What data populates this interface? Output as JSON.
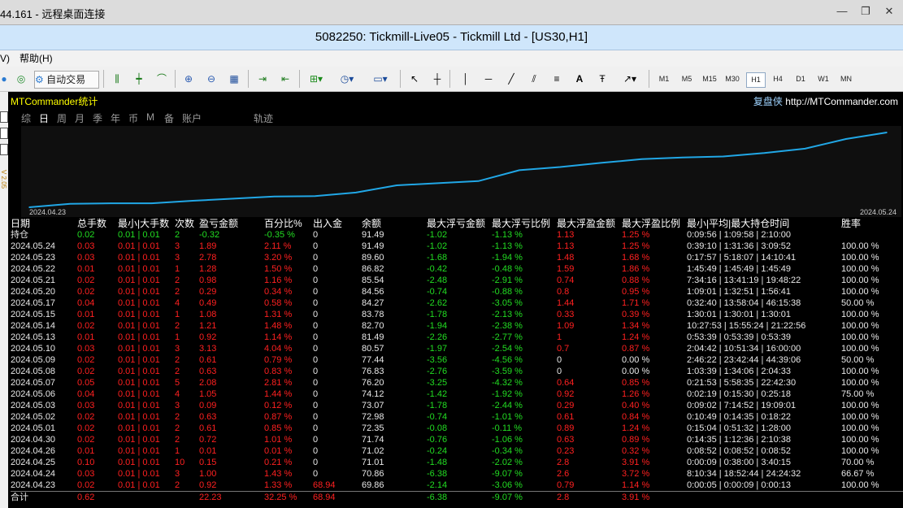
{
  "rdp": {
    "title": "44.161 - 远程桌面连接",
    "min": "—",
    "restore": "❐",
    "close": "✕"
  },
  "window_title": "5082250: Tickmill-Live05 - Tickmill Ltd - [US30,H1]",
  "menu": {
    "items": [
      "V)",
      "帮助(H)"
    ]
  },
  "toolbar": {
    "autotrade": "自动交易",
    "timeframes": [
      "M1",
      "M5",
      "M15",
      "M30",
      "H1",
      "H4",
      "D1",
      "W1",
      "MN"
    ],
    "selected_timeframe": "H1"
  },
  "left_strip": {
    "label": "V 2.05"
  },
  "panel": {
    "title": "MTCommander统计",
    "brand_name": "复盘侠",
    "brand_url": "http://MTCommander.com",
    "tabs": [
      {
        "label": "综",
        "active": false
      },
      {
        "label": "日",
        "active": true
      },
      {
        "label": "周",
        "active": false
      },
      {
        "label": "月",
        "active": false
      },
      {
        "label": "季",
        "active": false
      },
      {
        "label": "年",
        "active": false
      },
      {
        "label": "币",
        "active": false
      },
      {
        "label": "M",
        "active": false
      },
      {
        "label": "备",
        "active": false
      },
      {
        "label": "账户",
        "active": false
      },
      {
        "label": "轨迹",
        "active": false
      }
    ]
  },
  "chart_data": {
    "type": "line",
    "x": [
      "2024.04.23",
      "2024.04.24",
      "2024.04.25",
      "2024.04.26",
      "2024.04.30",
      "2024.05.01",
      "2024.05.02",
      "2024.05.03",
      "2024.05.06",
      "2024.05.07",
      "2024.05.08",
      "2024.05.09",
      "2024.05.10",
      "2024.05.13",
      "2024.05.14",
      "2024.05.15",
      "2024.05.17",
      "2024.05.20",
      "2024.05.21",
      "2024.05.22",
      "2024.05.23",
      "2024.05.24"
    ],
    "values": [
      69.86,
      70.86,
      71.01,
      71.02,
      71.74,
      72.35,
      72.98,
      73.07,
      74.12,
      76.2,
      76.83,
      77.44,
      80.57,
      81.49,
      82.7,
      83.78,
      84.27,
      84.56,
      85.54,
      86.82,
      89.6,
      91.49
    ],
    "x_start_label": "2024.04.23",
    "x_end_label": "2024.05.24",
    "line_color": "#21a7e6",
    "grid": false,
    "legend": "none"
  },
  "table": {
    "headers": [
      "日期",
      "总手数",
      "最小|大手数",
      "次数",
      "盈亏金额",
      "百分比%",
      "出入金",
      "余额",
      "最大浮亏金额",
      "最大浮亏比例",
      "最大浮盈金额",
      "最大浮盈比例",
      "最小|平均|最大持仓时间",
      "胜率"
    ],
    "holdings": {
      "label": "持仓",
      "lots": "0.02",
      "minmax": "0.01 | 0.01",
      "count": "2",
      "pnl": "-0.32",
      "pct": "-0.35 %",
      "dw": "0",
      "balance": "91.49",
      "fl": "-1.02",
      "flp": "-1.13 %",
      "fp": "1.13",
      "fpp": "1.25 %",
      "time": "0:09:56 | 1:09:58 | 2:10:00",
      "win": ""
    },
    "rows": [
      {
        "date": "2024.05.24",
        "lots": "0.03",
        "minmax": "0.01 | 0.01",
        "count": "3",
        "pnl": "1.89",
        "pct": "2.11 %",
        "dw": "0",
        "balance": "91.49",
        "fl": "-1.02",
        "flp": "-1.13 %",
        "fp": "1.13",
        "fpp": "1.25 %",
        "time": "0:39:10 | 1:31:36 | 3:09:52",
        "win": "100.00 %"
      },
      {
        "date": "2024.05.23",
        "lots": "0.03",
        "minmax": "0.01 | 0.01",
        "count": "3",
        "pnl": "2.78",
        "pct": "3.20 %",
        "dw": "0",
        "balance": "89.60",
        "fl": "-1.68",
        "flp": "-1.94 %",
        "fp": "1.48",
        "fpp": "1.68 %",
        "time": "0:17:57 | 5:18:07 | 14:10:41",
        "win": "100.00 %"
      },
      {
        "date": "2024.05.22",
        "lots": "0.01",
        "minmax": "0.01 | 0.01",
        "count": "1",
        "pnl": "1.28",
        "pct": "1.50 %",
        "dw": "0",
        "balance": "86.82",
        "fl": "-0.42",
        "flp": "-0.48 %",
        "fp": "1.59",
        "fpp": "1.86 %",
        "time": "1:45:49 | 1:45:49 | 1:45:49",
        "win": "100.00 %"
      },
      {
        "date": "2024.05.21",
        "lots": "0.02",
        "minmax": "0.01 | 0.01",
        "count": "2",
        "pnl": "0.98",
        "pct": "1.16 %",
        "dw": "0",
        "balance": "85.54",
        "fl": "-2.48",
        "flp": "-2.91 %",
        "fp": "0.74",
        "fpp": "0.88 %",
        "time": "7:34:16 | 13:41:19 | 19:48:22",
        "win": "100.00 %"
      },
      {
        "date": "2024.05.20",
        "lots": "0.02",
        "minmax": "0.01 | 0.01",
        "count": "2",
        "pnl": "0.29",
        "pct": "0.34 %",
        "dw": "0",
        "balance": "84.56",
        "fl": "-0.74",
        "flp": "-0.88 %",
        "fp": "0.8",
        "fpp": "0.95 %",
        "time": "1:09:01 | 1:32:51 | 1:56:41",
        "win": "100.00 %"
      },
      {
        "date": "2024.05.17",
        "lots": "0.04",
        "minmax": "0.01 | 0.01",
        "count": "4",
        "pnl": "0.49",
        "pct": "0.58 %",
        "dw": "0",
        "balance": "84.27",
        "fl": "-2.62",
        "flp": "-3.05 %",
        "fp": "1.44",
        "fpp": "1.71 %",
        "time": "0:32:40 | 13:58:04 | 46:15:38",
        "win": "50.00 %"
      },
      {
        "date": "2024.05.15",
        "lots": "0.01",
        "minmax": "0.01 | 0.01",
        "count": "1",
        "pnl": "1.08",
        "pct": "1.31 %",
        "dw": "0",
        "balance": "83.78",
        "fl": "-1.78",
        "flp": "-2.13 %",
        "fp": "0.33",
        "fpp": "0.39 %",
        "time": "1:30:01 | 1:30:01 | 1:30:01",
        "win": "100.00 %"
      },
      {
        "date": "2024.05.14",
        "lots": "0.02",
        "minmax": "0.01 | 0.01",
        "count": "2",
        "pnl": "1.21",
        "pct": "1.48 %",
        "dw": "0",
        "balance": "82.70",
        "fl": "-1.94",
        "flp": "-2.38 %",
        "fp": "1.09",
        "fpp": "1.34 %",
        "time": "10:27:53 | 15:55:24 | 21:22:56",
        "win": "100.00 %"
      },
      {
        "date": "2024.05.13",
        "lots": "0.01",
        "minmax": "0.01 | 0.01",
        "count": "1",
        "pnl": "0.92",
        "pct": "1.14 %",
        "dw": "0",
        "balance": "81.49",
        "fl": "-2.26",
        "flp": "-2.77 %",
        "fp": "1",
        "fpp": "1.24 %",
        "time": "0:53:39 | 0:53:39 | 0:53:39",
        "win": "100.00 %"
      },
      {
        "date": "2024.05.10",
        "lots": "0.03",
        "minmax": "0.01 | 0.01",
        "count": "3",
        "pnl": "3.13",
        "pct": "4.04 %",
        "dw": "0",
        "balance": "80.57",
        "fl": "-1.97",
        "flp": "-2.54 %",
        "fp": "0.7",
        "fpp": "0.87 %",
        "time": "2:04:42 | 10:51:34 | 16:00:00",
        "win": "100.00 %"
      },
      {
        "date": "2024.05.09",
        "lots": "0.02",
        "minmax": "0.01 | 0.01",
        "count": "2",
        "pnl": "0.61",
        "pct": "0.79 %",
        "dw": "0",
        "balance": "77.44",
        "fl": "-3.56",
        "flp": "-4.56 %",
        "fp": "0",
        "fpp": "0.00 %",
        "time": "2:46:22 | 23:42:44 | 44:39:06",
        "win": "50.00 %"
      },
      {
        "date": "2024.05.08",
        "lots": "0.02",
        "minmax": "0.01 | 0.01",
        "count": "2",
        "pnl": "0.63",
        "pct": "0.83 %",
        "dw": "0",
        "balance": "76.83",
        "fl": "-2.76",
        "flp": "-3.59 %",
        "fp": "0",
        "fpp": "0.00 %",
        "time": "1:03:39 | 1:34:06 | 2:04:33",
        "win": "100.00 %"
      },
      {
        "date": "2024.05.07",
        "lots": "0.05",
        "minmax": "0.01 | 0.01",
        "count": "5",
        "pnl": "2.08",
        "pct": "2.81 %",
        "dw": "0",
        "balance": "76.20",
        "fl": "-3.25",
        "flp": "-4.32 %",
        "fp": "0.64",
        "fpp": "0.85 %",
        "time": "0:21:53 | 5:58:35 | 22:42:30",
        "win": "100.00 %"
      },
      {
        "date": "2024.05.06",
        "lots": "0.04",
        "minmax": "0.01 | 0.01",
        "count": "4",
        "pnl": "1.05",
        "pct": "1.44 %",
        "dw": "0",
        "balance": "74.12",
        "fl": "-1.42",
        "flp": "-1.92 %",
        "fp": "0.92",
        "fpp": "1.26 %",
        "time": "0:02:19 | 0:15:30 | 0:25:18",
        "win": "75.00 %"
      },
      {
        "date": "2024.05.03",
        "lots": "0.03",
        "minmax": "0.01 | 0.01",
        "count": "3",
        "pnl": "0.09",
        "pct": "0.12 %",
        "dw": "0",
        "balance": "73.07",
        "fl": "-1.78",
        "flp": "-2.44 %",
        "fp": "0.29",
        "fpp": "0.40 %",
        "time": "0:09:02 | 7:14:52 | 19:09:01",
        "win": "100.00 %"
      },
      {
        "date": "2024.05.02",
        "lots": "0.02",
        "minmax": "0.01 | 0.01",
        "count": "2",
        "pnl": "0.63",
        "pct": "0.87 %",
        "dw": "0",
        "balance": "72.98",
        "fl": "-0.74",
        "flp": "-1.01 %",
        "fp": "0.61",
        "fpp": "0.84 %",
        "time": "0:10:49 | 0:14:35 | 0:18:22",
        "win": "100.00 %"
      },
      {
        "date": "2024.05.01",
        "lots": "0.02",
        "minmax": "0.01 | 0.01",
        "count": "2",
        "pnl": "0.61",
        "pct": "0.85 %",
        "dw": "0",
        "balance": "72.35",
        "fl": "-0.08",
        "flp": "-0.11 %",
        "fp": "0.89",
        "fpp": "1.24 %",
        "time": "0:15:04 | 0:51:32 | 1:28:00",
        "win": "100.00 %"
      },
      {
        "date": "2024.04.30",
        "lots": "0.02",
        "minmax": "0.01 | 0.01",
        "count": "2",
        "pnl": "0.72",
        "pct": "1.01 %",
        "dw": "0",
        "balance": "71.74",
        "fl": "-0.76",
        "flp": "-1.06 %",
        "fp": "0.63",
        "fpp": "0.89 %",
        "time": "0:14:35 | 1:12:36 | 2:10:38",
        "win": "100.00 %"
      },
      {
        "date": "2024.04.26",
        "lots": "0.01",
        "minmax": "0.01 | 0.01",
        "count": "1",
        "pnl": "0.01",
        "pct": "0.01 %",
        "dw": "0",
        "balance": "71.02",
        "fl": "-0.24",
        "flp": "-0.34 %",
        "fp": "0.23",
        "fpp": "0.32 %",
        "time": "0:08:52 | 0:08:52 | 0:08:52",
        "win": "100.00 %"
      },
      {
        "date": "2024.04.25",
        "lots": "0.10",
        "minmax": "0.01 | 0.01",
        "count": "10",
        "pnl": "0.15",
        "pct": "0.21 %",
        "dw": "0",
        "balance": "71.01",
        "fl": "-1.48",
        "flp": "-2.02 %",
        "fp": "2.8",
        "fpp": "3.91 %",
        "time": "0:00:09 | 0:38:00 | 3:40:15",
        "win": "70.00 %"
      },
      {
        "date": "2024.04.24",
        "lots": "0.03",
        "minmax": "0.01 | 0.01",
        "count": "3",
        "pnl": "1.00",
        "pct": "1.43 %",
        "dw": "0",
        "balance": "70.86",
        "fl": "-6.38",
        "flp": "-9.07 %",
        "fp": "2.6",
        "fpp": "3.72 %",
        "time": "8:10:34 | 18:52:44 | 24:24:32",
        "win": "66.67 %"
      },
      {
        "date": "2024.04.23",
        "lots": "0.02",
        "minmax": "0.01 | 0.01",
        "count": "2",
        "pnl": "0.92",
        "pct": "1.33 %",
        "dw": "68.94",
        "balance": "69.86",
        "fl": "-2.14",
        "flp": "-3.06 %",
        "fp": "0.79",
        "fpp": "1.14 %",
        "time": "0:00:05 | 0:00:09 | 0:00:13",
        "win": "100.00 %"
      }
    ],
    "total": {
      "label": "合计",
      "lots": "0.62",
      "pnl": "22.23",
      "pct": "32.25 %",
      "dw": "68.94",
      "fl": "-6.38",
      "flp": "-9.07 %",
      "fp": "2.8",
      "fpp": "3.91 %"
    }
  }
}
